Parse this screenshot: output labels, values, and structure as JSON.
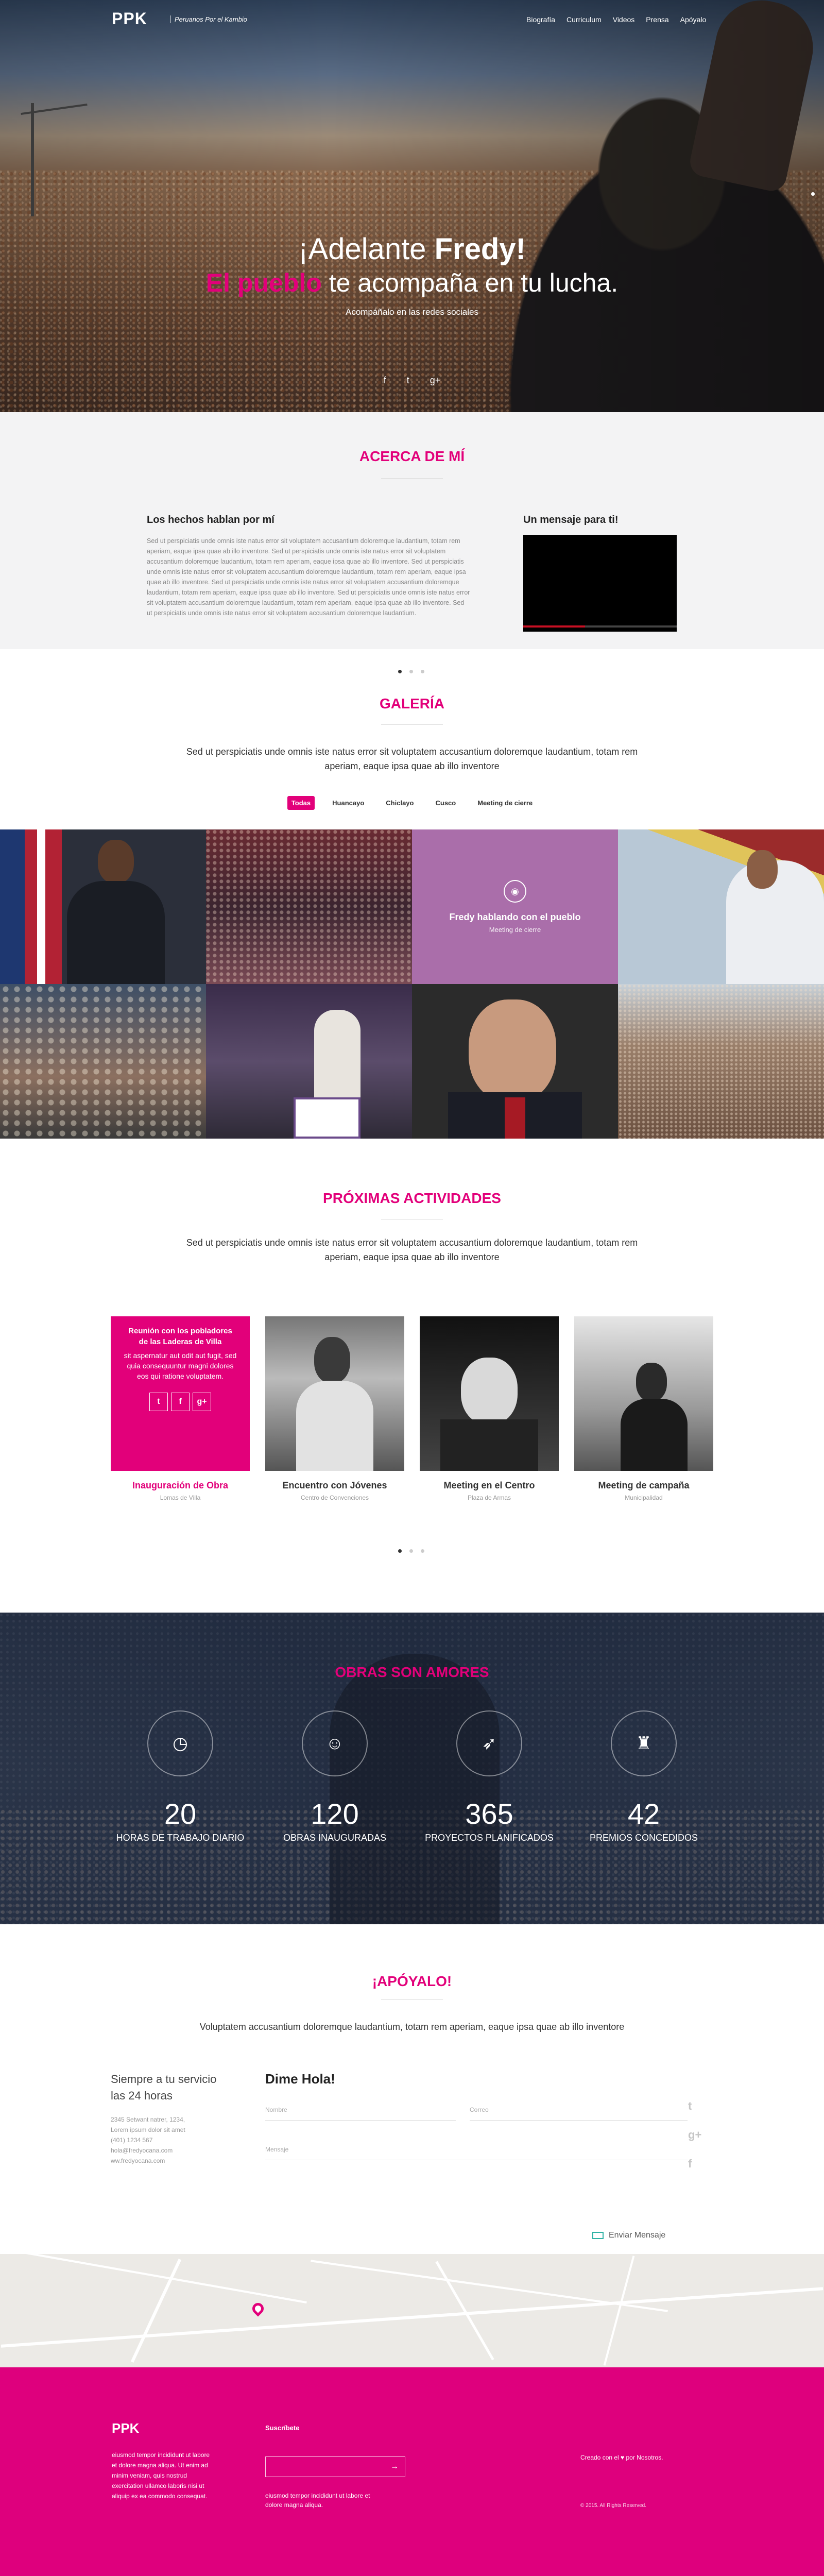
{
  "header": {
    "logo": "PPK",
    "tagline": "Peruanos Por el Kambio",
    "nav": [
      "Biografía",
      "Curriculum",
      "Videos",
      "Prensa",
      "Apóyalo"
    ]
  },
  "hero": {
    "title_pre": "¡Adelante ",
    "title_bold": "Fredy!",
    "sub_pink": "El pueblo",
    "sub_rest": " te acompaña en tu lucha.",
    "social": "Acompáñalo en las redes sociales",
    "icons": [
      "f",
      "t",
      "g+"
    ]
  },
  "about": {
    "title": "ACERCA DE MÍ",
    "left_heading": "Los hechos hablan por mí",
    "left_text": "Sed ut perspiciatis unde omnis iste natus error sit voluptatem accusantium doloremque laudantium, totam rem aperiam, eaque ipsa quae ab illo inventore. Sed ut perspiciatis unde omnis iste natus error sit voluptatem accusantium doloremque laudantium, totam rem aperiam, eaque ipsa quae ab illo inventore. Sed ut perspiciatis unde omnis iste natus error sit voluptatem accusantium doloremque laudantium, totam rem aperiam, eaque ipsa quae ab illo inventore. Sed ut perspiciatis unde omnis iste natus error sit voluptatem accusantium doloremque laudantium, totam rem aperiam, eaque ipsa quae ab illo inventore. Sed ut perspiciatis unde omnis iste natus error sit voluptatem accusantium doloremque laudantium, totam rem aperiam, eaque ipsa quae ab illo inventore. Sed ut perspiciatis unde omnis iste natus error sit voluptatem accusantium doloremque laudantium.",
    "right_heading": "Un mensaje para ti!"
  },
  "gallery": {
    "title": "GALERÍA",
    "intro": "Sed ut perspiciatis unde omnis iste natus error sit voluptatem accusantium doloremque laudantium, totam rem aperiam, eaque ipsa quae ab illo inventore",
    "filters": [
      "Todas",
      "Huancayo",
      "Chiclayo",
      "Cusco",
      "Meeting de cierre"
    ],
    "overlay_title": "Fredy hablando con el pueblo",
    "overlay_sub": "Meeting de cierre"
  },
  "activities": {
    "title": "PRÓXIMAS ACTIVIDADES",
    "intro": "Sed ut perspiciatis unde omnis iste natus error sit voluptatem accusantium doloremque laudantium, totam rem aperiam, eaque ipsa quae ab illo inventore",
    "featured_heading": "Reunión con los pobladores de las Laderas de Villa",
    "featured_text": "sit aspernatur aut odit aut fugit, sed quia consequuntur magni dolores eos qui ratione voluptatem.",
    "social": [
      "t",
      "f",
      "g+"
    ],
    "cards": [
      {
        "title": "Inauguración de Obra",
        "place": "Lomas de Villa"
      },
      {
        "title": "Encuentro con Jóvenes",
        "place": "Centro de Convenciones"
      },
      {
        "title": "Meeting en el Centro",
        "place": "Plaza de Armas"
      },
      {
        "title": "Meeting de campaña",
        "place": "Municipalidad"
      }
    ]
  },
  "stats": {
    "title": "OBRAS SON AMORES",
    "items": [
      {
        "num": "20",
        "label": "HORAS DE TRABAJO DIARIO"
      },
      {
        "num": "120",
        "label": "OBRAS INAUGURADAS"
      },
      {
        "num": "365",
        "label": "PROYECTOS PLANIFICADOS"
      },
      {
        "num": "42",
        "label": "PREMIOS CONCEDIDOS"
      }
    ]
  },
  "support": {
    "title": "¡APÓYALO!",
    "intro": "Voluptatem accusantium doloremque laudantium, totam rem aperiam, eaque ipsa quae ab illo inventore",
    "left_heading_1": "Siempre a tu servicio",
    "left_heading_2": "las 24 horas",
    "address": [
      "2345 Setwant natrer, 1234,",
      "Lorem ipsum dolor sit amet",
      "(401) 1234 567",
      "hola@fredyocana.com",
      "ww.fredyocana.com"
    ],
    "form_title": "Dime Hola!",
    "name_placeholder": "Nombre",
    "email_placeholder": "Correo",
    "message_placeholder": "Mensaje",
    "send_label": "Enviar Mensaje"
  },
  "footer": {
    "logo": "PPK",
    "text": "eiusmod tempor incididunt ut labore et dolore magna aliqua. Ut enim ad minim veniam, quis nostrud exercitation ullamco laboris nisi ut aliquip ex ea commodo consequat.",
    "subscribe": "Suscríbete",
    "sub_text": "eiusmod tempor incididunt ut labore et dolore magna aliqua.",
    "credit": "Creado con el ♥ por Nosotros.",
    "copyright": "© 2015. All Rights Reserved."
  },
  "colors": {
    "accent": "#e2007a",
    "footer": "#de007d"
  }
}
